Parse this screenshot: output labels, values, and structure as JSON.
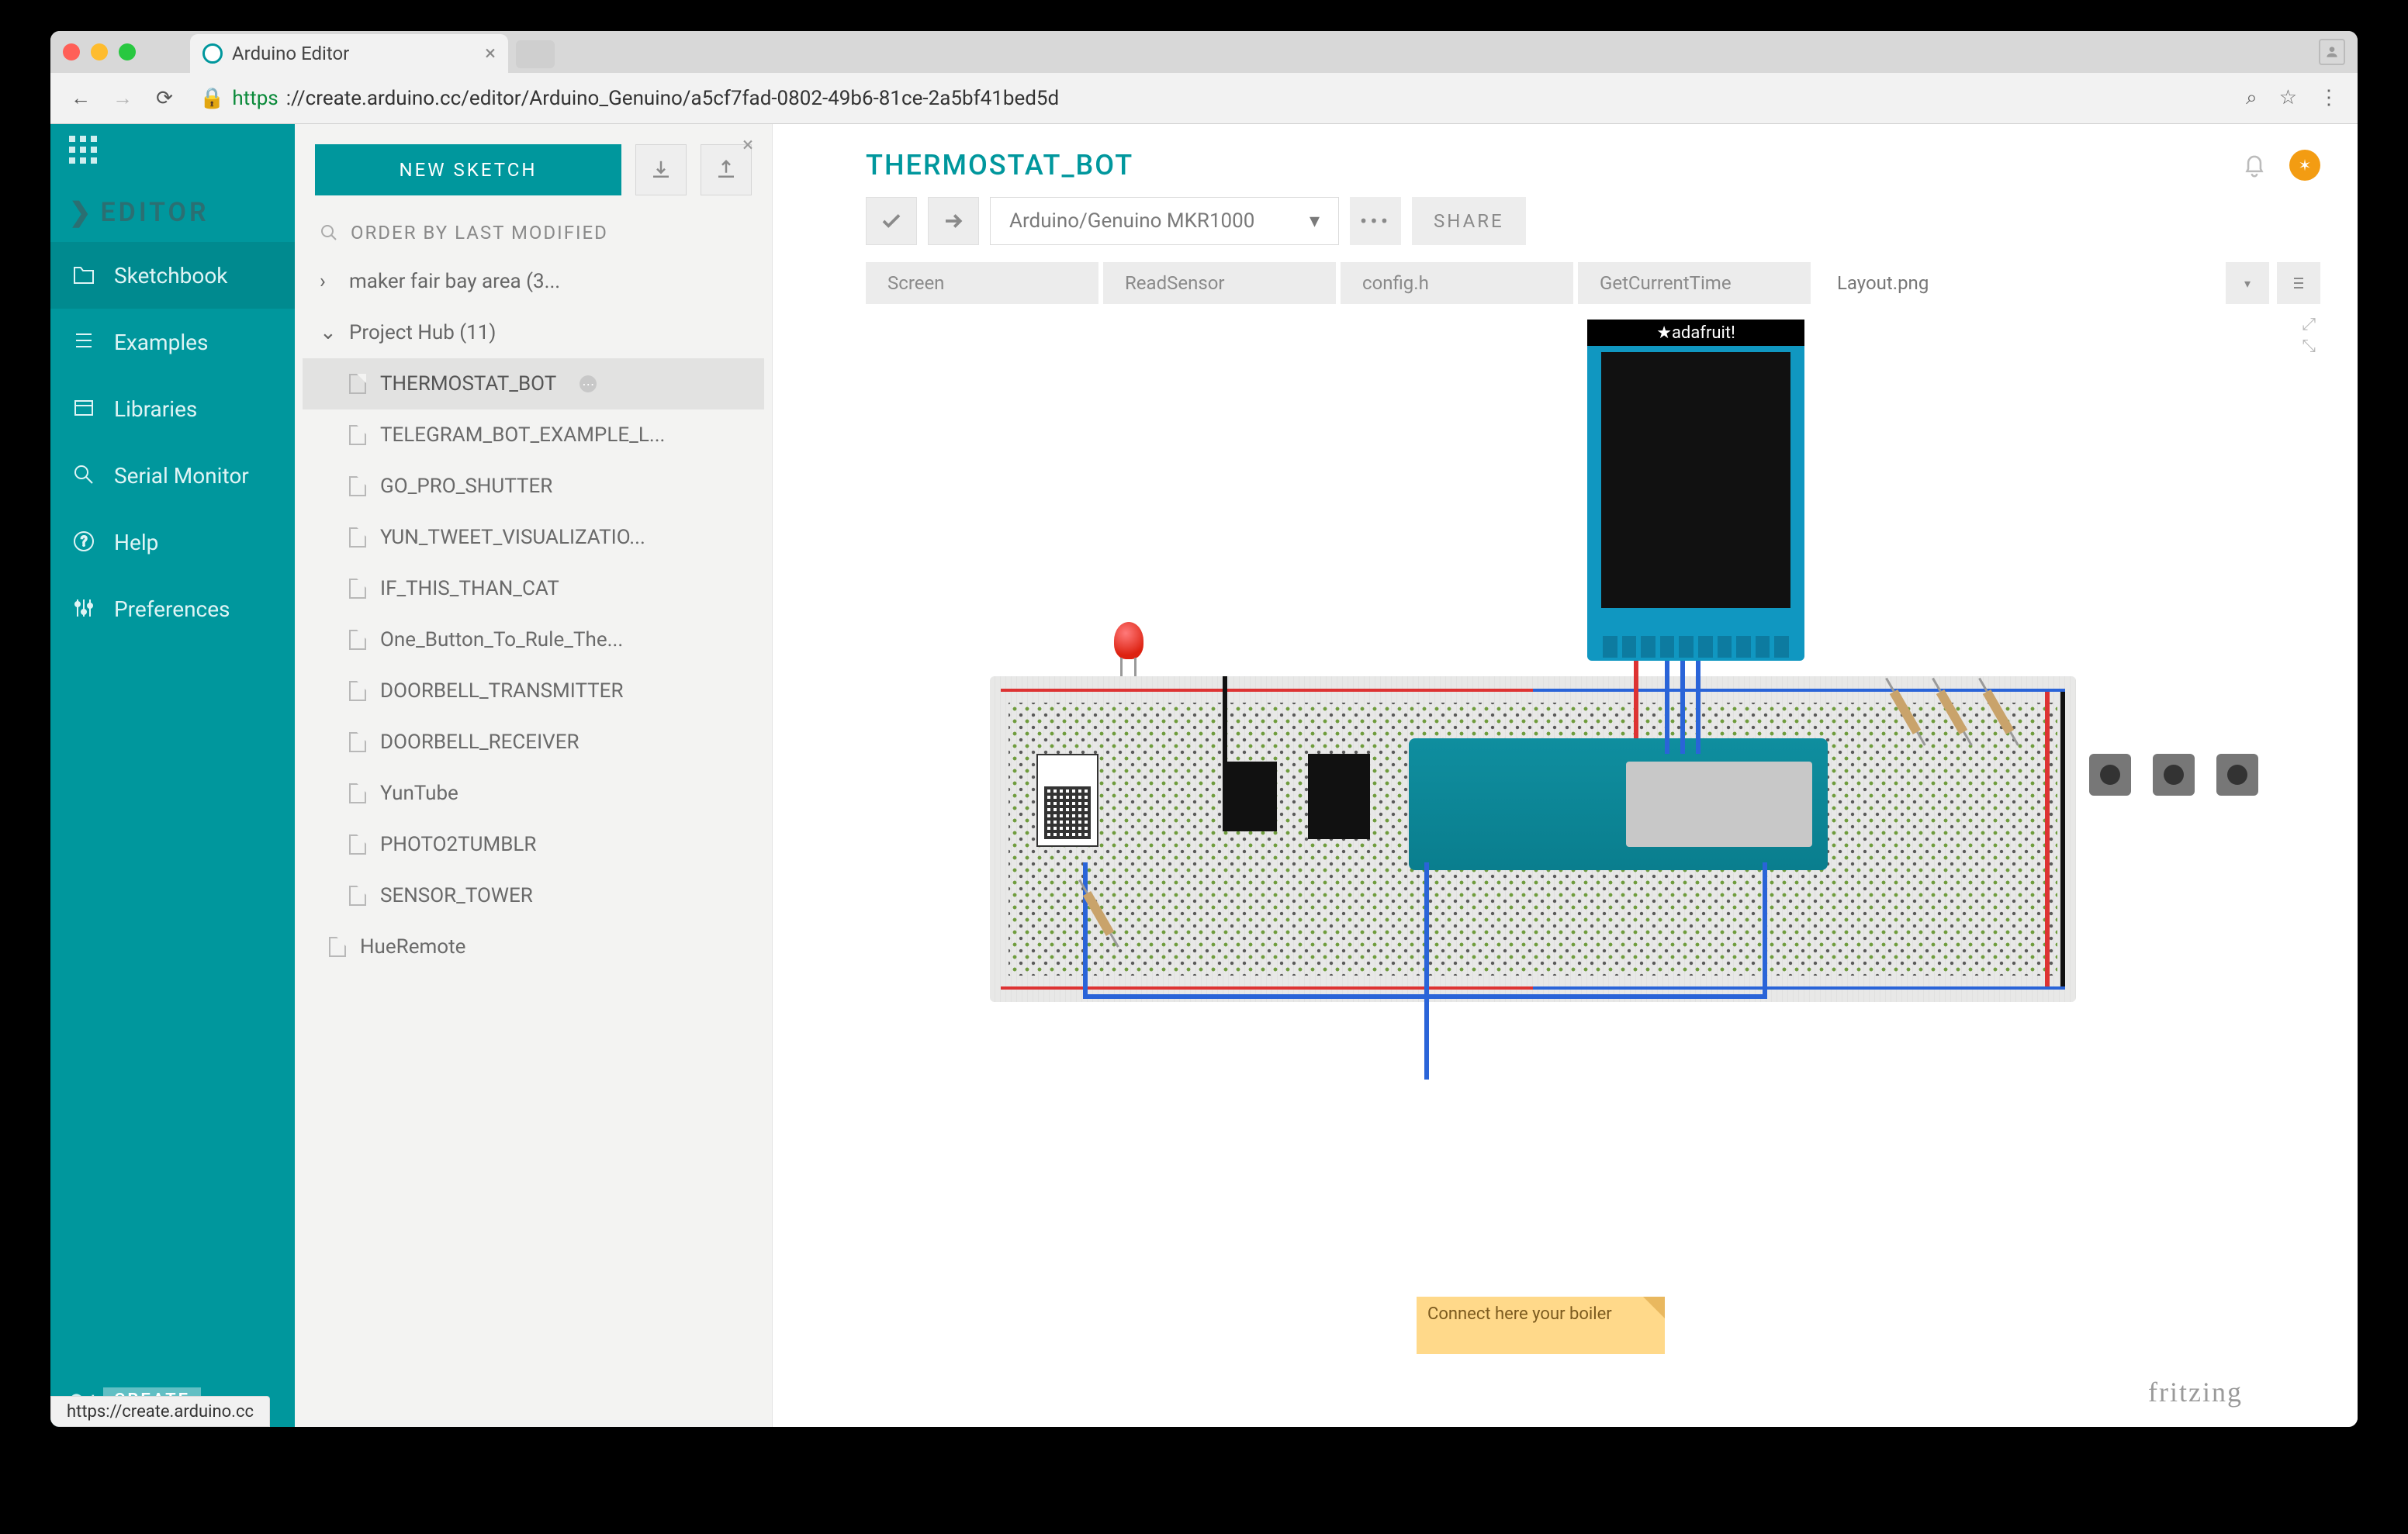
{
  "browser": {
    "tab_title": "Arduino Editor",
    "url_scheme": "https",
    "url_rest": "://create.arduino.cc/editor/Arduino_Genuino/a5cf7fad-0802-49b6-81ce-2a5bf41bed5d",
    "status_url": "https://create.arduino.cc"
  },
  "rail": {
    "editor_label": "EDITOR",
    "items": [
      {
        "label": "Sketchbook"
      },
      {
        "label": "Examples"
      },
      {
        "label": "Libraries"
      },
      {
        "label": "Serial Monitor"
      },
      {
        "label": "Help"
      },
      {
        "label": "Preferences"
      }
    ],
    "create_badge": "CREATE"
  },
  "panel": {
    "new_sketch": "NEW SKETCH",
    "order_label": "ORDER BY LAST MODIFIED",
    "folders": [
      {
        "label": "maker fair bay area (3...",
        "expanded": false
      },
      {
        "label": "Project Hub (11)",
        "expanded": true
      }
    ],
    "files": [
      "THERMOSTAT_BOT",
      "TELEGRAM_BOT_EXAMPLE_L...",
      "GO_PRO_SHUTTER",
      "YUN_TWEET_VISUALIZATIO...",
      "IF_THIS_THAN_CAT",
      "One_Button_To_Rule_The...",
      "DOORBELL_TRANSMITTER",
      "DOORBELL_RECEIVER",
      "YunTube",
      "PHOTO2TUMBLR",
      "SENSOR_TOWER"
    ],
    "root_file": "HueRemote",
    "selected": "THERMOSTAT_BOT"
  },
  "main": {
    "title": "THERMOSTAT_BOT",
    "board": "Arduino/Genuino MKR1000",
    "share": "SHARE",
    "tabs": [
      "Screen",
      "ReadSensor",
      "config.h",
      "GetCurrentTime",
      "Layout.png"
    ],
    "active_tab": "Layout.png",
    "tft_label": "★adafruit!",
    "sticky": "Connect here your boiler",
    "fritzing": "fritzing"
  }
}
